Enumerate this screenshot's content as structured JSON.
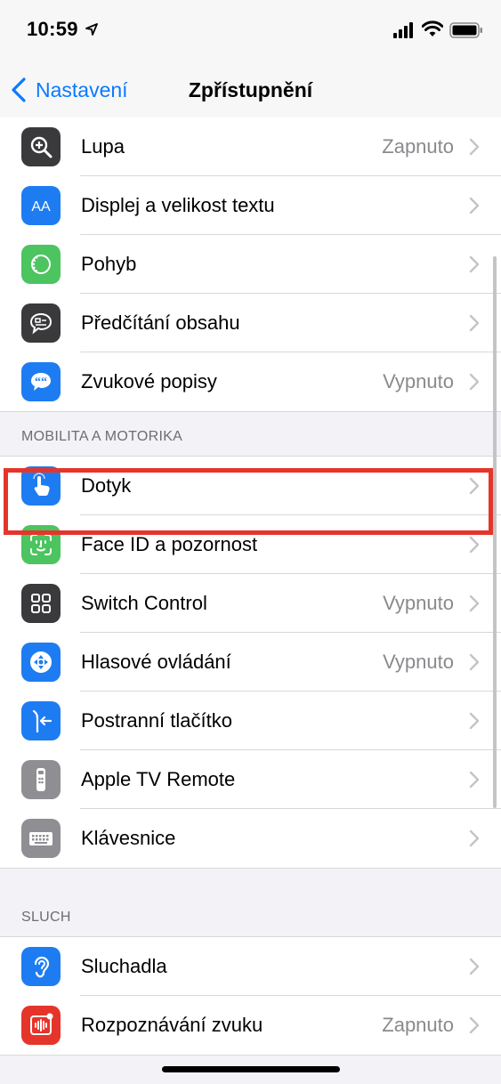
{
  "status_bar": {
    "time": "10:59"
  },
  "nav": {
    "back_label": "Nastavení",
    "title": "Zpřístupnění"
  },
  "group_vision": [
    {
      "label": "Lupa",
      "value": "Zapnuto",
      "icon": "magnifier-icon",
      "color": "#3a3a3c"
    },
    {
      "label": "Displej a velikost textu",
      "value": "",
      "icon": "text-size-icon",
      "color": "#1e7cf2"
    },
    {
      "label": "Pohyb",
      "value": "",
      "icon": "motion-icon",
      "color": "#4cc460"
    },
    {
      "label": "Předčítání obsahu",
      "value": "",
      "icon": "speech-bubble-icon",
      "color": "#3a3a3c"
    },
    {
      "label": "Zvukové popisy",
      "value": "Vypnuto",
      "icon": "quote-bubble-icon",
      "color": "#1e7cf2"
    }
  ],
  "section_mobility": "MOBILITA A MOTORIKA",
  "group_mobility": [
    {
      "label": "Dotyk",
      "value": "",
      "icon": "hand-pointer-icon",
      "color": "#1e7cf2"
    },
    {
      "label": "Face ID a pozornost",
      "value": "",
      "icon": "face-id-icon",
      "color": "#4cc460"
    },
    {
      "label": "Switch Control",
      "value": "Vypnuto",
      "icon": "switch-control-icon",
      "color": "#3a3a3c"
    },
    {
      "label": "Hlasové ovládání",
      "value": "Vypnuto",
      "icon": "voice-control-icon",
      "color": "#1e7cf2"
    },
    {
      "label": "Postranní tlačítko",
      "value": "",
      "icon": "side-button-icon",
      "color": "#1e7cf2"
    },
    {
      "label": "Apple TV Remote",
      "value": "",
      "icon": "tv-remote-icon",
      "color": "#8e8e93"
    },
    {
      "label": "Klávesnice",
      "value": "",
      "icon": "keyboard-icon",
      "color": "#8e8e93"
    }
  ],
  "section_hearing": "SLUCH",
  "group_hearing": [
    {
      "label": "Sluchadla",
      "value": "",
      "icon": "ear-icon",
      "color": "#1e7cf2"
    },
    {
      "label": "Rozpoznávání zvuku",
      "value": "Zapnuto",
      "icon": "sound-recognition-icon",
      "color": "#e5352b"
    }
  ]
}
